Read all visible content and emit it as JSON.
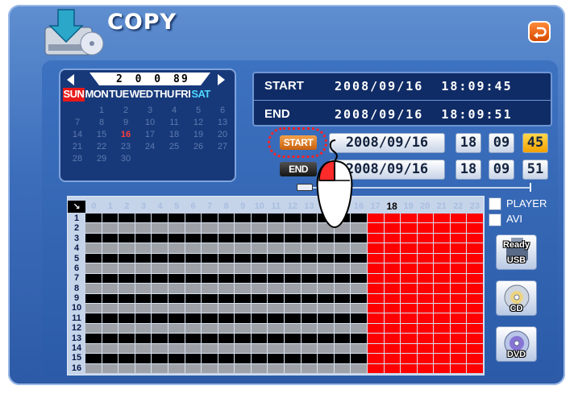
{
  "header": {
    "title": "COPY"
  },
  "calendar": {
    "year": "2 0 0 8",
    "month": "9",
    "weekdays": [
      "SUN",
      "MON",
      "TUE",
      "WED",
      "THU",
      "FRI",
      "SAT"
    ],
    "weeks": [
      [
        "",
        "1",
        "2",
        "3",
        "4",
        "5",
        "6"
      ],
      [
        "7",
        "8",
        "9",
        "10",
        "11",
        "12",
        "13"
      ],
      [
        "14",
        "15",
        "16",
        "17",
        "18",
        "19",
        "20"
      ],
      [
        "21",
        "22",
        "23",
        "24",
        "25",
        "26",
        "27"
      ],
      [
        "28",
        "29",
        "30",
        "",
        "",
        "",
        ""
      ]
    ],
    "selected_day": "16"
  },
  "range": {
    "start_label": "START",
    "start_value": "2008/09/16  18:09:45",
    "end_label": "END",
    "end_value": "2008/09/16  18:09:51"
  },
  "set_start": {
    "label": "START",
    "date": "2008/09/16",
    "hour": "18",
    "minute": "09",
    "second": "45"
  },
  "set_end": {
    "label": "END",
    "date": "2008/09/16",
    "hour": "18",
    "minute": "09",
    "second": "51"
  },
  "grid": {
    "hours": [
      "0",
      "1",
      "2",
      "3",
      "4",
      "5",
      "6",
      "7",
      "8",
      "9",
      "10",
      "11",
      "12",
      "13",
      "14",
      "15",
      "16",
      "17",
      "18",
      "19",
      "20",
      "21",
      "22",
      "23"
    ],
    "current_hour": "18",
    "channels": [
      "1",
      "2",
      "3",
      "4",
      "5",
      "6",
      "7",
      "8",
      "9",
      "10",
      "11",
      "12",
      "13",
      "14",
      "15",
      "16"
    ],
    "corner_glyph": "↘"
  },
  "options": {
    "player_label": "PLAYER",
    "avi_label": "AVI"
  },
  "devices": {
    "usb_status": "Ready",
    "usb_label": "USB",
    "cd_label": "CD",
    "dvd_label": "DVD"
  },
  "colors": {
    "accent": "#f3a100",
    "record": "#000000",
    "selected": "#ff0000",
    "background": "#3c6dbb"
  }
}
